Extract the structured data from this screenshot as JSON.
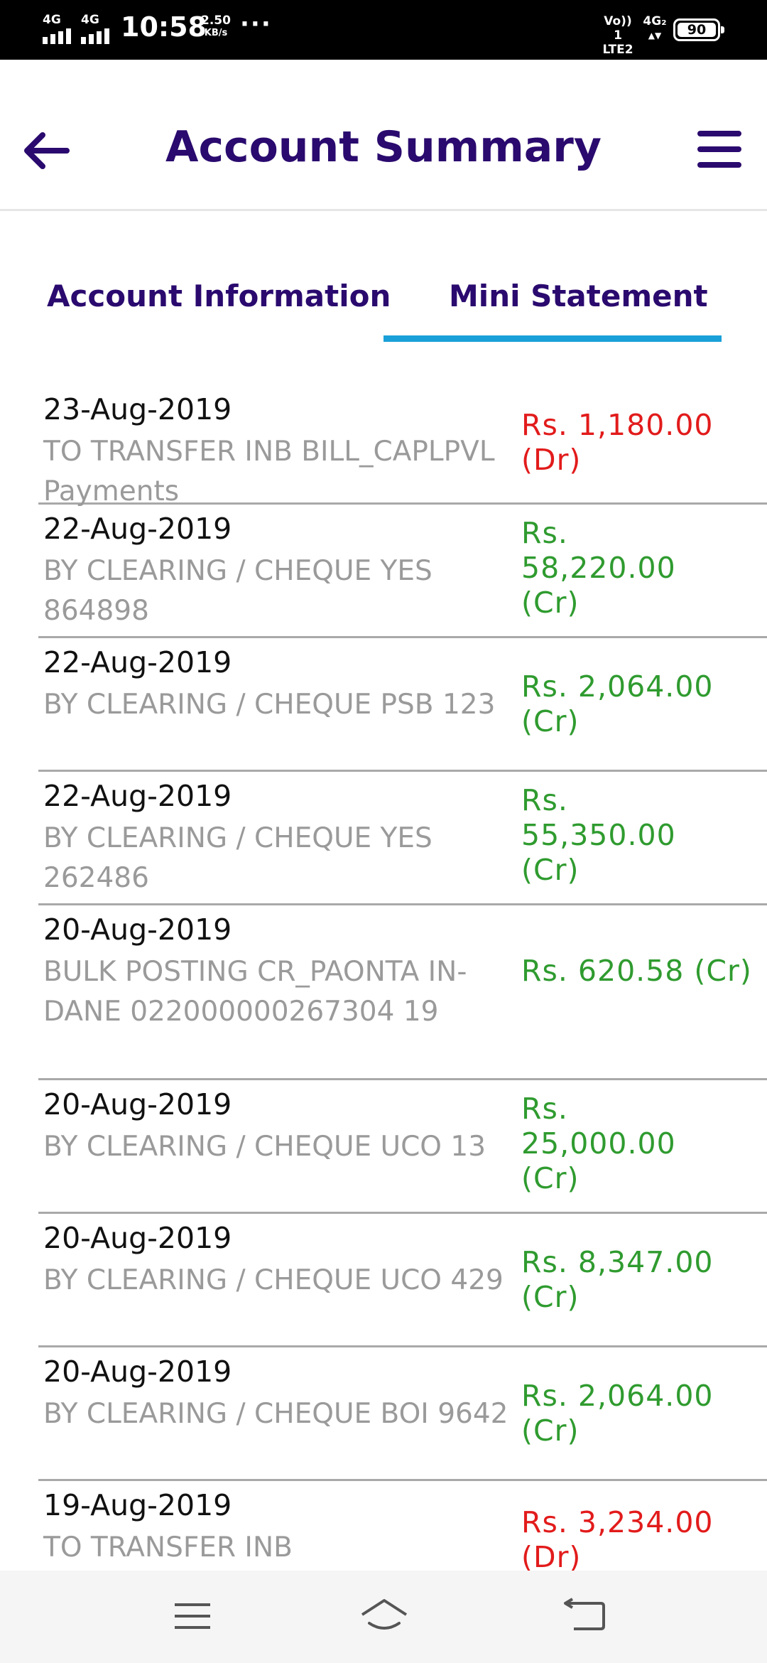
{
  "status_bar": {
    "network1": "4G",
    "network2": "4G",
    "time": "10:58",
    "speed_value": "2.50",
    "speed_unit": "KB/s",
    "more": "···",
    "volte": "Vo)) 1",
    "lte2": "LTE2",
    "net3": "4G₂",
    "battery": "90"
  },
  "header": {
    "title": "Account Summary",
    "back_icon": "arrow-left-icon",
    "menu_icon": "hamburger-menu-icon"
  },
  "tabs": [
    {
      "label": "Account Information",
      "selected": false
    },
    {
      "label": "Mini Statement",
      "selected": true
    }
  ],
  "statement": [
    {
      "date": "23-Aug-2019",
      "desc": "TO TRANSFER INB BILL_CAPLPVL Payments",
      "amount": "Rs. 1,180.00 (Dr)",
      "type": "dr"
    },
    {
      "date": "22-Aug-2019",
      "desc": "BY CLEARING / CHEQUE YES 864898",
      "amount": "Rs. 58,220.00 (Cr)",
      "type": "cr"
    },
    {
      "date": "22-Aug-2019",
      "desc": "BY CLEARING / CHEQUE PSB 123",
      "amount": "Rs. 2,064.00 (Cr)",
      "type": "cr"
    },
    {
      "date": "22-Aug-2019",
      "desc": "BY CLEARING / CHEQUE YES 262486",
      "amount": "Rs. 55,350.00 (Cr)",
      "type": "cr"
    },
    {
      "date": "20-Aug-2019",
      "desc": "BULK POSTING CR_PAONTA IN-DANE 022000000267304 19",
      "amount": "Rs. 620.58 (Cr)",
      "type": "cr"
    },
    {
      "date": "20-Aug-2019",
      "desc": "BY CLEARING / CHEQUE UCO 13",
      "amount": "Rs. 25,000.00 (Cr)",
      "type": "cr"
    },
    {
      "date": "20-Aug-2019",
      "desc": "BY CLEARING / CHEQUE UCO 429",
      "amount": "Rs. 8,347.00 (Cr)",
      "type": "cr"
    },
    {
      "date": "20-Aug-2019",
      "desc": "BY CLEARING / CHEQUE BOI 9642",
      "amount": "Rs. 2,064.00 (Cr)",
      "type": "cr"
    },
    {
      "date": "19-Aug-2019",
      "desc": "TO TRANSFER INB",
      "amount": "Rs. 3,234.00 (Dr)",
      "type": "dr"
    }
  ],
  "colors": {
    "title": "#2a0a6e",
    "tab_underline": "#1aa0d8",
    "debit": "#e21b1b",
    "credit": "#2f9b2f",
    "desc": "#9a9a9a"
  },
  "bottom_nav": {
    "menu_icon": "recent-apps-icon",
    "home_icon": "home-icon",
    "back_icon": "back-icon"
  }
}
